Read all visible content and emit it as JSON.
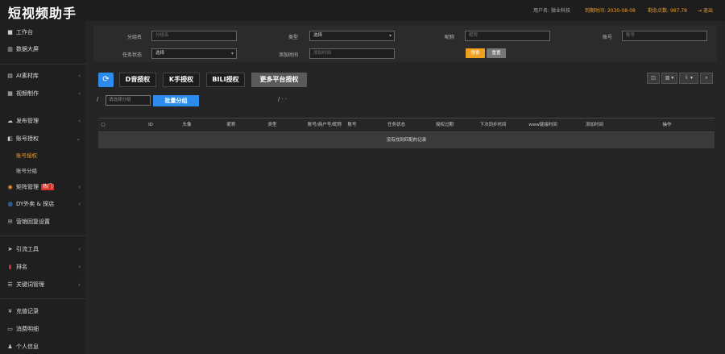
{
  "header": {
    "app_title": "短视频助手",
    "username_label": "用户名:",
    "username": "微业科技",
    "expire_label": "到期时间:",
    "expire": "2030-08-08",
    "points_label": "剩余点数:",
    "points": "987.78",
    "logout": "退出"
  },
  "sidebar": {
    "items": [
      {
        "icon": "■",
        "label": "工作台"
      },
      {
        "icon": "▥",
        "label": "数据大屏"
      },
      {
        "icon": "▤",
        "label": "AI素材库"
      },
      {
        "icon": "▦",
        "label": "视频制作"
      },
      {
        "icon": "☁",
        "label": "发布管理"
      },
      {
        "icon": "◧",
        "label": "账号授权"
      },
      {
        "label": "账号授权"
      },
      {
        "label": "账号分组"
      },
      {
        "icon": "◉",
        "label": "矩阵管理",
        "badge": "热门"
      },
      {
        "icon": "◍",
        "label": "DY外卖 & 探店"
      },
      {
        "icon": "✉",
        "label": "营销回复设置"
      },
      {
        "icon": "➤",
        "label": "引流工具"
      },
      {
        "icon": "▮",
        "label": "排名"
      },
      {
        "icon": "☰",
        "label": "关键词管理"
      },
      {
        "icon": "¥",
        "label": "充值记录"
      },
      {
        "icon": "▭",
        "label": "消费明细"
      },
      {
        "icon": "♟",
        "label": "个人信息"
      }
    ]
  },
  "filter": {
    "group_label": "分组名",
    "group_placeholder": "分组名",
    "type_label": "类型",
    "type_value": "选择",
    "nickname_label": "昵称",
    "nickname_placeholder": "昵称",
    "account_label": "账号",
    "account_placeholder": "账号",
    "task_label": "任务状态",
    "task_value": "选择",
    "addtime_label": "添加时间",
    "addtime_placeholder": "添加时间",
    "search": "搜索",
    "reset": "重置"
  },
  "toolbar": {
    "refresh": "⟳",
    "platforms": [
      "D音授权",
      "K手授权",
      "BILI授权",
      "更多平台授权"
    ],
    "tools": [
      "◫",
      "▥ ▾",
      "⇩ ▾",
      "⌕"
    ]
  },
  "popup": {
    "input_placeholder": "请选择分组",
    "button": "批量分组"
  },
  "table": {
    "columns": [
      "ID",
      "头像",
      "昵称",
      "类型",
      "账号/商户号/昵称",
      "账号",
      "任务状态",
      "授权过期",
      "下次同步时间",
      "www链接时间",
      "添加时间",
      "操作"
    ],
    "empty_text": "没有找到匹配的记录"
  }
}
